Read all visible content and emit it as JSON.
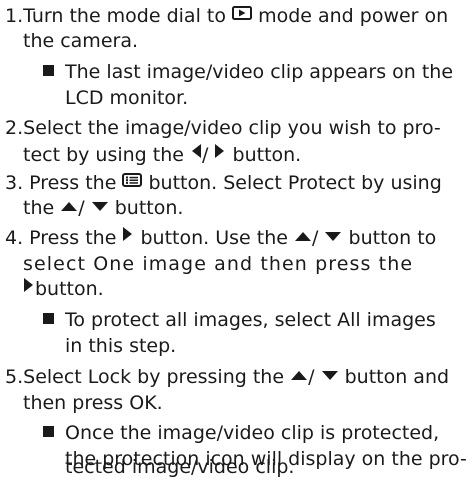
{
  "steps": {
    "s1": {
      "a": "1.Turn the mode dial to",
      "b": "mode and  power on",
      "l2": "the camera.",
      "note_a": "The last image/video clip appears on the",
      "note_b": "LCD monitor."
    },
    "s2": {
      "l1": "2.Select the image/video clip you wish to pro-",
      "l2a": "tect by using the",
      "l2b": "button."
    },
    "s3": {
      "l1a": "3. Press the",
      "l1b": "button. Select Protect by using",
      "l2a": "the",
      "l2b": "button."
    },
    "s4": {
      "l1a": "4. Press the",
      "l1b": "button. Use the",
      "l1c": "button to",
      "l2": "select One image and then press the",
      "l3": "button.",
      "note_a": "To protect all images, select All images",
      "note_b": "in this step."
    },
    "s5": {
      "l1a": "5.Select Lock by pressing the",
      "l1b": "button and",
      "l2": "then press OK.",
      "note_a": "Once the image/video clip is protected,",
      "note_b": "the protection icon will display on the pro-",
      "note_c": "tected image/video clip."
    }
  },
  "icons": {
    "playback": "playback-mode-icon",
    "left": "left-arrow-icon",
    "right": "right-arrow-icon",
    "up": "up-arrow-icon",
    "down": "down-arrow-icon",
    "menu": "menu-button-icon",
    "bullet": "square-bullet-icon"
  }
}
